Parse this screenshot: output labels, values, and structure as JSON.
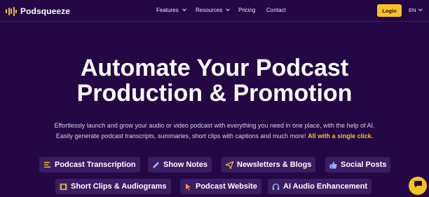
{
  "brand": {
    "name": "Podsqueeze",
    "accent": "#f6c324",
    "background": "#230845"
  },
  "nav": {
    "items": [
      {
        "label": "Features",
        "has_dropdown": true
      },
      {
        "label": "Resources",
        "has_dropdown": true
      },
      {
        "label": "Pricing",
        "has_dropdown": false
      },
      {
        "label": "Contact",
        "has_dropdown": false
      }
    ],
    "login_label": "Login",
    "language": "EN"
  },
  "hero": {
    "title_line1": "Automate Your Podcast",
    "title_line2": "Production & Promotion",
    "subtitle_line1": "Effortlessly launch and grow your audio or video podcast with everything you need in one place, with the help of AI.",
    "subtitle_line2": "Easily generate podcast transcripts, summaries, short clips with captions and much more!",
    "subtitle_highlight": "All with a single click."
  },
  "features": [
    {
      "label": "Podcast Transcription",
      "icon": "transcript-lines-icon"
    },
    {
      "label": "Show Notes",
      "icon": "pen-icon"
    },
    {
      "label": "Newsletters & Blogs",
      "icon": "paper-plane-icon"
    },
    {
      "label": "Social Posts",
      "icon": "thumbs-up-icon"
    },
    {
      "label": "Short Clips & Audiograms",
      "icon": "film-icon"
    },
    {
      "label": "Podcast Website",
      "icon": "cursor-icon"
    },
    {
      "label": "AI Audio Enhancement",
      "icon": "headphones-icon"
    }
  ],
  "chat": {
    "icon": "chat-bubble-icon"
  }
}
